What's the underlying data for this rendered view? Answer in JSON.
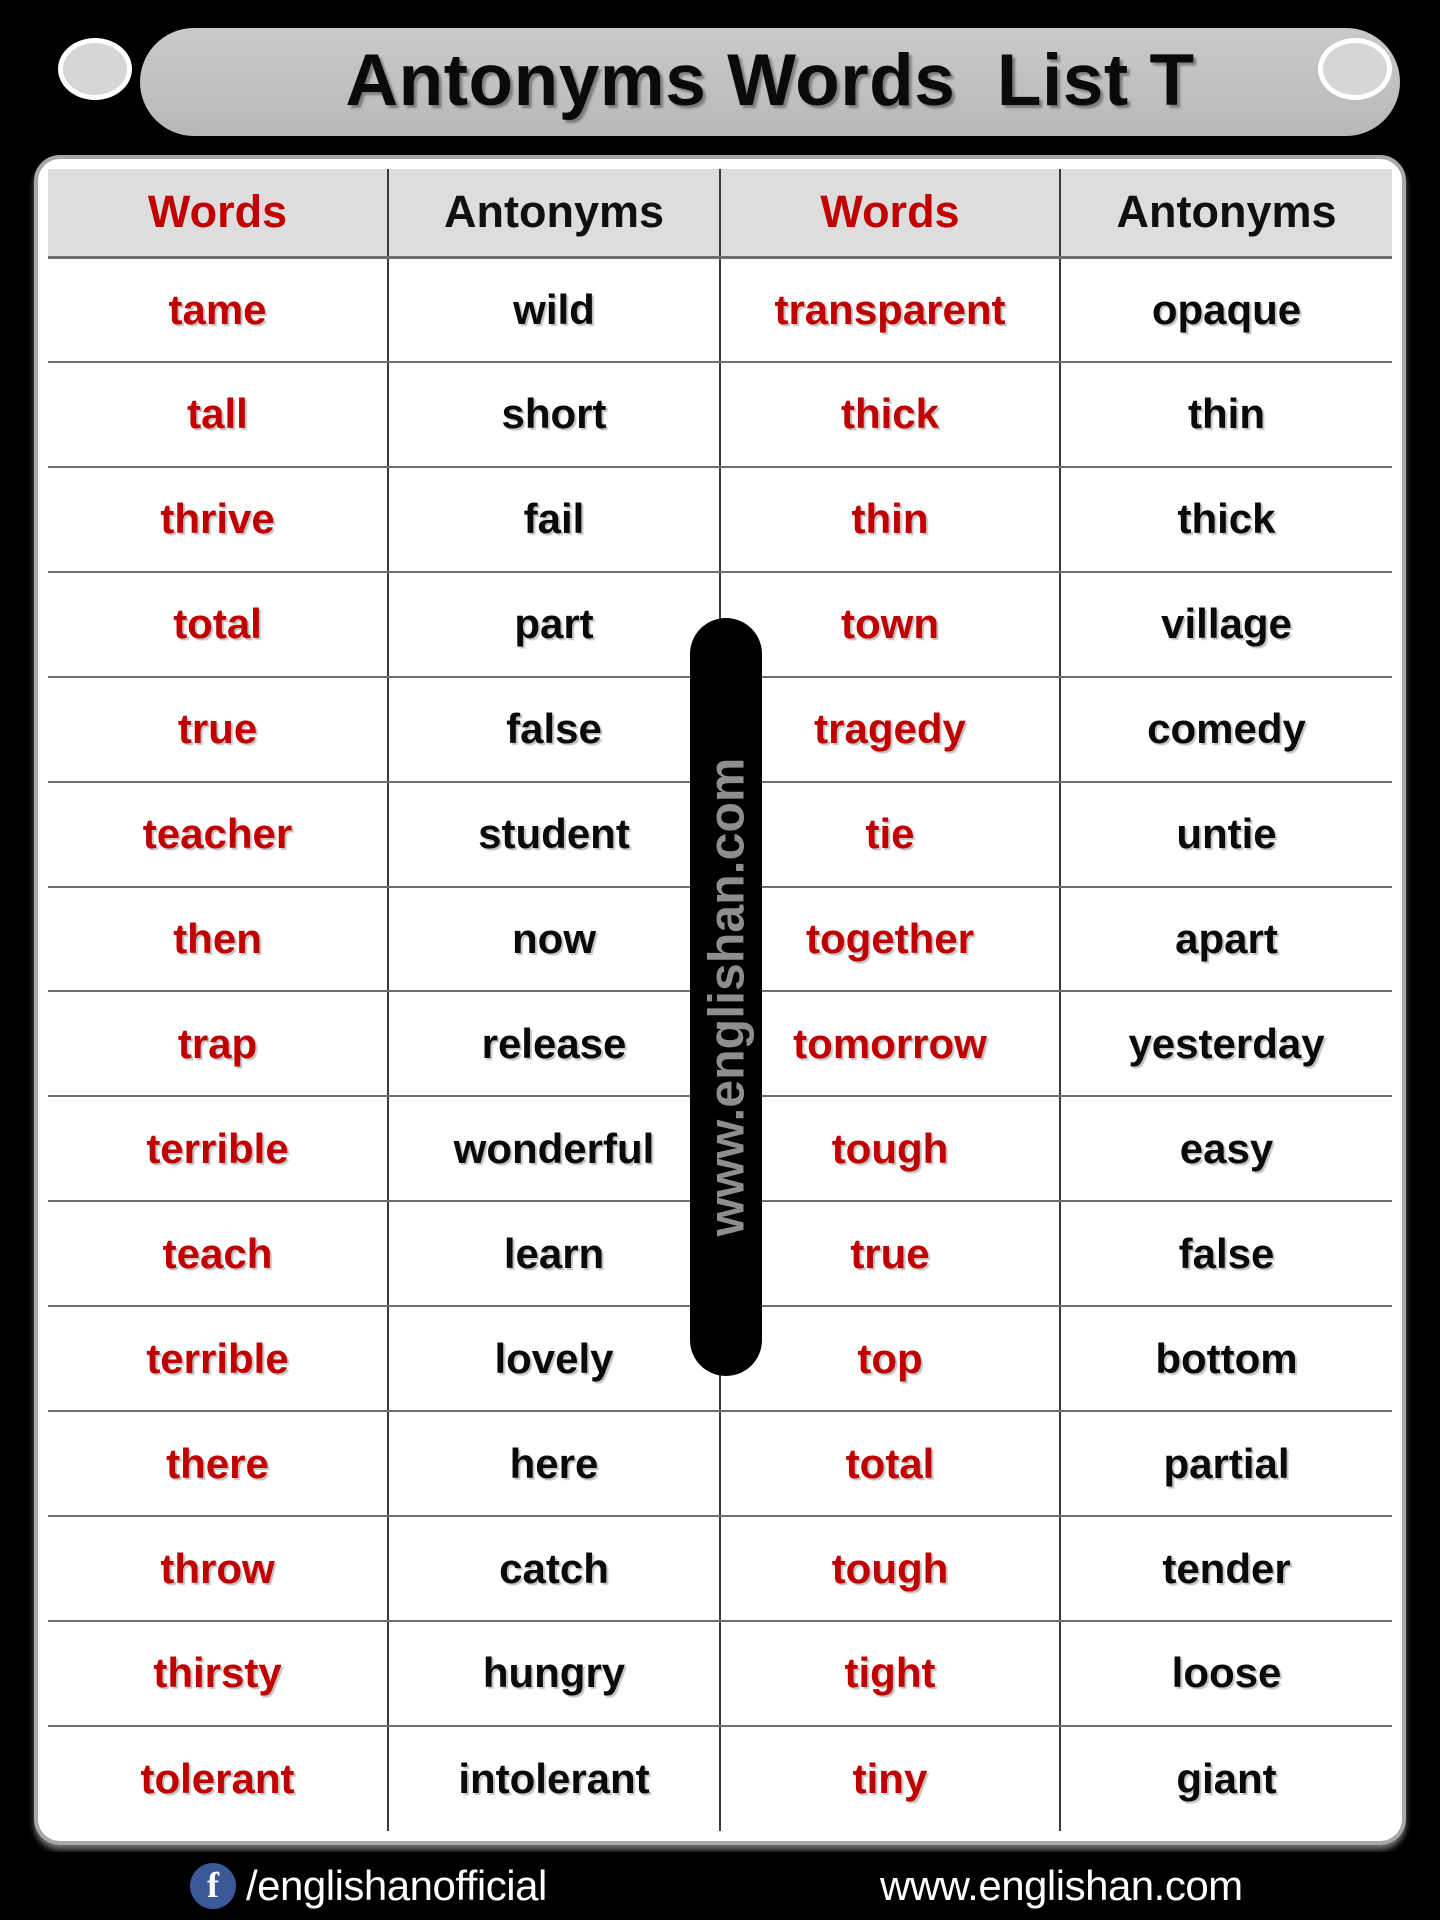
{
  "header": {
    "title": "Antonyms Words  List T",
    "knob_left_icon": "oval-knob-icon",
    "knob_right_icon": "oval-knob-icon"
  },
  "colors": {
    "word_red": "#C00000",
    "antonym_black": "#0A0A0A",
    "banner_gray": "#C2C2C2",
    "header_row_gray": "#DDDDDD",
    "page_black": "#000000",
    "facebook_blue": "#3B5998"
  },
  "table": {
    "columns": [
      {
        "label": "Words",
        "accent": "red"
      },
      {
        "label": "Antonyms",
        "accent": "black"
      },
      {
        "label": "Words",
        "accent": "red"
      },
      {
        "label": "Antonyms",
        "accent": "black"
      }
    ],
    "rows": [
      {
        "w1": "tame",
        "a1": "wild",
        "w2": "transparent",
        "a2": "opaque"
      },
      {
        "w1": "tall",
        "a1": "short",
        "w2": "thick",
        "a2": "thin"
      },
      {
        "w1": "thrive",
        "a1": "fail",
        "w2": "thin",
        "a2": "thick"
      },
      {
        "w1": "total",
        "a1": "part",
        "w2": "town",
        "a2": "village"
      },
      {
        "w1": "true",
        "a1": "false",
        "w2": "tragedy",
        "a2": "comedy"
      },
      {
        "w1": "teacher",
        "a1": "student",
        "w2": "tie",
        "a2": "untie"
      },
      {
        "w1": "then",
        "a1": "now",
        "w2": "together",
        "a2": "apart"
      },
      {
        "w1": "trap",
        "a1": "release",
        "w2": "tomorrow",
        "a2": "yesterday"
      },
      {
        "w1": "terrible",
        "a1": "wonderful",
        "w2": "tough",
        "a2": "easy"
      },
      {
        "w1": "teach",
        "a1": "learn",
        "w2": "true",
        "a2": "false"
      },
      {
        "w1": "terrible",
        "a1": "lovely",
        "w2": "top",
        "a2": "bottom"
      },
      {
        "w1": "there",
        "a1": "here",
        "w2": "total",
        "a2": "partial"
      },
      {
        "w1": "throw",
        "a1": "catch",
        "w2": "tough",
        "a2": "tender"
      },
      {
        "w1": "thirsty",
        "a1": "hungry",
        "w2": "tight",
        "a2": "loose"
      },
      {
        "w1": "tolerant",
        "a1": "intolerant",
        "w2": "tiny",
        "a2": "giant"
      }
    ]
  },
  "watermark": {
    "text": "www.englishan.com"
  },
  "footer": {
    "facebook_icon": "facebook-icon",
    "facebook_glyph": "f",
    "facebook_handle": "/englishanofficial",
    "website": "www.englishan.com"
  }
}
